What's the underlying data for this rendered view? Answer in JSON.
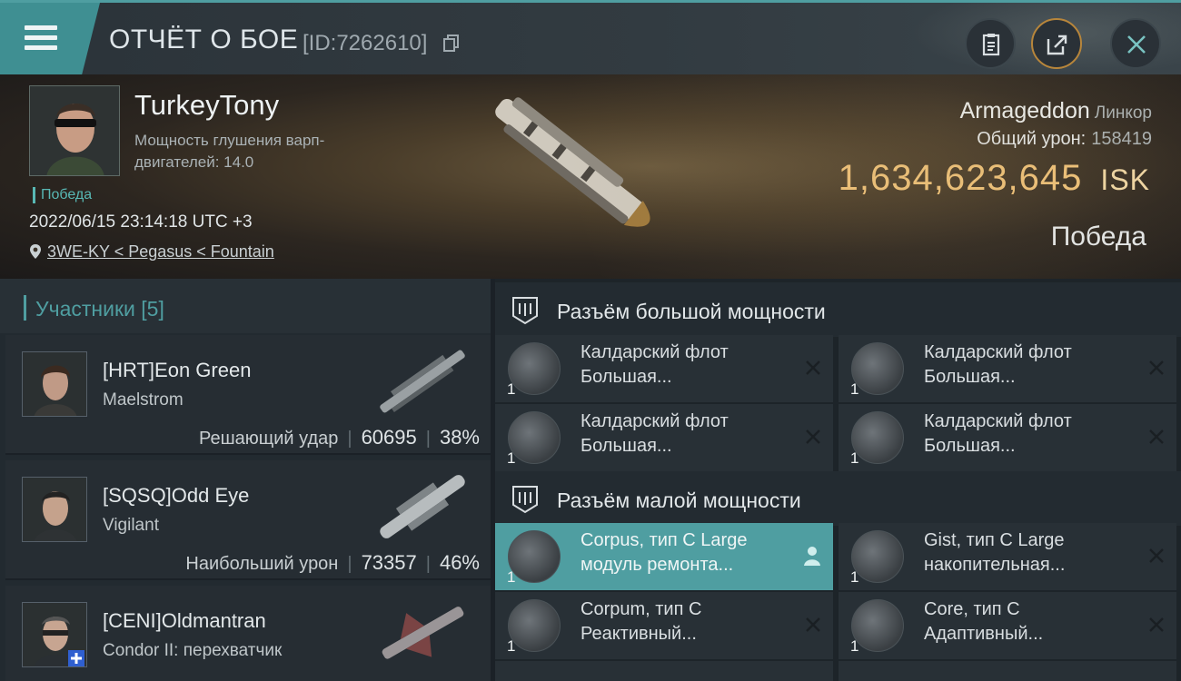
{
  "header": {
    "title": "ОТЧЁТ О БОЕ",
    "report_id": "[ID:7262610]"
  },
  "hero": {
    "pilot_name": "TurkeyTony",
    "jam_label": "Мощность глушения варп-двигателей: 14.0",
    "victory_badge": "Победа",
    "datetime": "2022/06/15 23:14:18 UTC +3",
    "location": "3WE-KY < Pegasus < Fountain",
    "ship_name": "Armageddon",
    "ship_class": "Линкор",
    "total_damage_label": "Общий урон:",
    "total_damage": "158419",
    "isk_value": "1,634,623,645",
    "isk_unit": "ISK",
    "result": "Победа"
  },
  "participants": {
    "header": "Участники [5]",
    "rows": [
      {
        "name": "[HRT]Eon Green",
        "ship": "Maelstrom",
        "role": "Решающий удар",
        "damage": "60695",
        "percent": "38%"
      },
      {
        "name": "[SQSQ]Odd Eye",
        "ship": "Vigilant",
        "role": "Наибольший урон",
        "damage": "73357",
        "percent": "46%"
      },
      {
        "name": "[CENI]Oldmantran",
        "ship": "Condor II: перехватчик",
        "role": "",
        "damage": "",
        "percent": ""
      }
    ]
  },
  "fitting": {
    "high_slot_title": "Разъём большой мощности",
    "low_slot_title": "Разъём малой мощности",
    "high_modules": [
      {
        "qty": "1",
        "name_line1": "Калдарский флот",
        "name_line2": "Большая..."
      },
      {
        "qty": "1",
        "name_line1": "Калдарский флот",
        "name_line2": "Большая..."
      },
      {
        "qty": "1",
        "name_line1": "Калдарский флот",
        "name_line2": "Большая..."
      },
      {
        "qty": "1",
        "name_line1": "Калдарский флот",
        "name_line2": "Большая..."
      }
    ],
    "low_modules": [
      {
        "qty": "1",
        "name_line1": "Corpus, тип C Large",
        "name_line2": "модуль ремонта..."
      },
      {
        "qty": "1",
        "name_line1": "Gist, тип C Large",
        "name_line2": "накопительная..."
      },
      {
        "qty": "1",
        "name_line1": "Corpum, тип C",
        "name_line2": "Реактивный..."
      },
      {
        "qty": "1",
        "name_line1": "Core, тип C",
        "name_line2": "Адаптивный..."
      }
    ]
  },
  "colors": {
    "accent": "#4f9ea1",
    "isk": "#f0c37a"
  },
  "icons": [
    "menu-icon",
    "copy-icon",
    "clipboard-icon",
    "share-icon",
    "close-icon",
    "location-pin-icon",
    "slot-icon",
    "remove-icon",
    "person-icon",
    "module-icon"
  ]
}
